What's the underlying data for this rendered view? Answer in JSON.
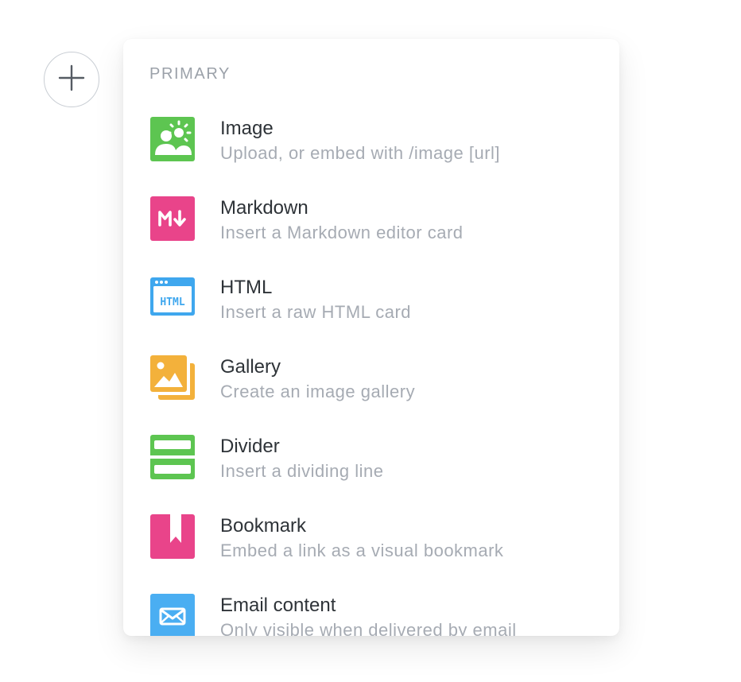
{
  "menu": {
    "section_label": "PRIMARY",
    "items": [
      {
        "title": "Image",
        "description": "Upload, or embed with /image [url]",
        "icon": "image-icon",
        "color": "#5dc551"
      },
      {
        "title": "Markdown",
        "description": "Insert a Markdown editor card",
        "icon": "markdown-icon",
        "color": "#e9448a"
      },
      {
        "title": "HTML",
        "description": "Insert a raw HTML card",
        "icon": "html-icon",
        "color": "#3fa7ee"
      },
      {
        "title": "Gallery",
        "description": "Create an image gallery",
        "icon": "gallery-icon",
        "color": "#f3b13b"
      },
      {
        "title": "Divider",
        "description": "Insert a dividing line",
        "icon": "divider-icon",
        "color": "#5dc551"
      },
      {
        "title": "Bookmark",
        "description": "Embed a link as a visual bookmark",
        "icon": "bookmark-icon",
        "color": "#e9448a"
      },
      {
        "title": "Email content",
        "description": "Only visible when delivered by email",
        "icon": "email-icon",
        "color": "#4aaef2"
      }
    ]
  },
  "add_button": {
    "icon": "plus-icon"
  }
}
